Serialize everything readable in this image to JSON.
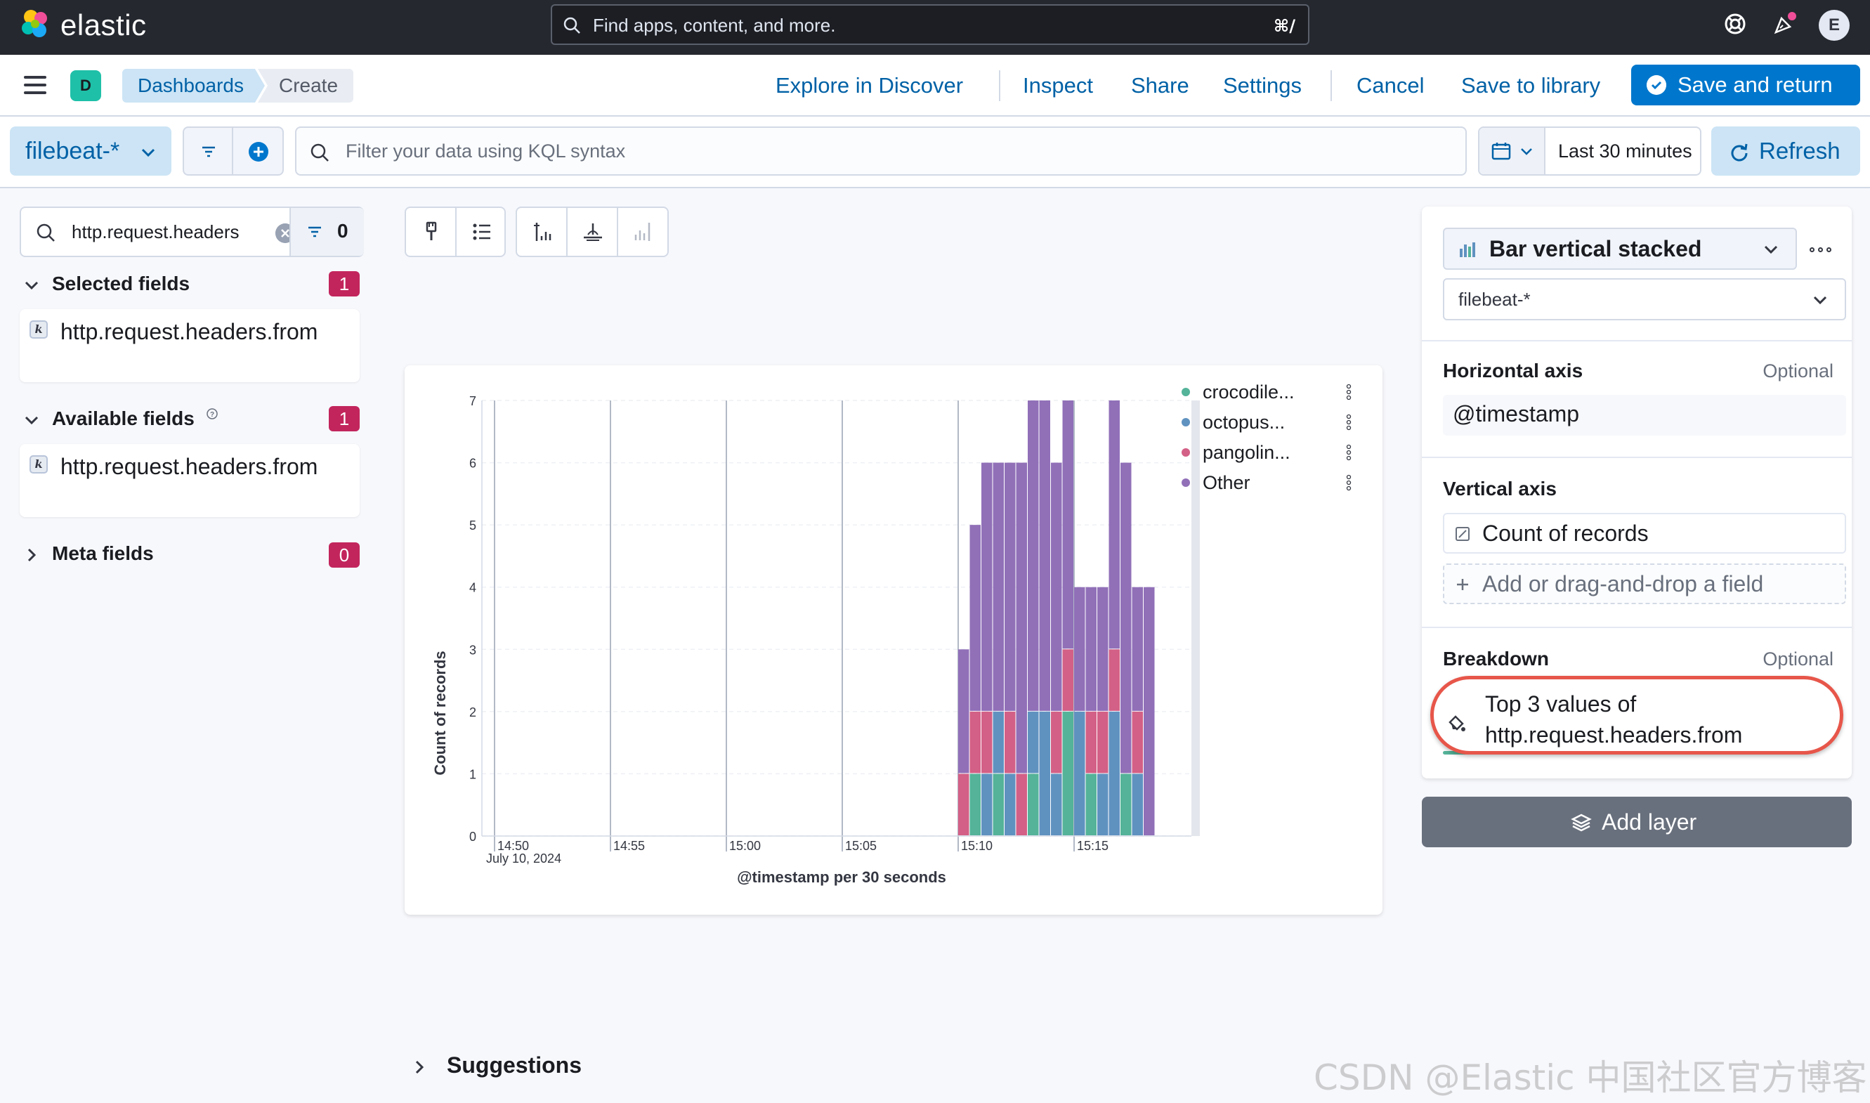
{
  "header": {
    "logo_text": "elastic",
    "search_placeholder": "Find apps, content, and more.",
    "search_shortcut": "⌘/",
    "avatar_initial": "E"
  },
  "appbar": {
    "space_initial": "D",
    "breadcrumbs": [
      "Dashboards",
      "Create"
    ],
    "links": [
      "Explore in Discover",
      "Inspect",
      "Share",
      "Settings",
      "Cancel",
      "Save to library"
    ],
    "save_return_label": "Save and return"
  },
  "querybar": {
    "data_view": "filebeat-*",
    "kql_placeholder": "Filter your data using KQL syntax",
    "time_range": "Last 30 minutes",
    "refresh_label": "Refresh"
  },
  "field_list": {
    "search_value": "http.request.headers",
    "filter_count": "0",
    "sections": [
      {
        "title": "Selected fields",
        "count": "1",
        "fields": [
          "http.request.headers.from"
        ]
      },
      {
        "title": "Available fields",
        "count": "1",
        "fields": [
          "http.request.headers.from"
        ]
      },
      {
        "title": "Meta fields",
        "count": "0",
        "fields": []
      }
    ]
  },
  "workspace": {
    "toolbar_icons": [
      "paintbrush-icon",
      "legend-icon",
      "left-axis-icon",
      "bottom-axis-icon",
      "right-axis-icon"
    ],
    "suggestions_label": "Suggestions"
  },
  "chart_data": {
    "type": "bar",
    "stacked": true,
    "title": "",
    "xlabel": "@timestamp per 30 seconds",
    "ylabel": "Count of records",
    "ylim": [
      0,
      7
    ],
    "y_ticks": [
      0,
      1,
      2,
      3,
      4,
      5,
      6,
      7
    ],
    "x_tick_labels": [
      "14:50",
      "14:55",
      "15:00",
      "15:05",
      "15:10",
      "15:15"
    ],
    "x_sub_label": "July 10, 2024",
    "x": [
      "15:10:30",
      "15:11:00",
      "15:11:30",
      "15:12:00",
      "15:12:30",
      "15:13:00",
      "15:13:30",
      "15:14:00",
      "15:14:30",
      "15:15:00",
      "15:15:30",
      "15:16:00",
      "15:16:30",
      "15:17:00",
      "15:17:30",
      "15:18:00",
      "15:18:30"
    ],
    "series": [
      {
        "name": "crocodile...",
        "color": "#54b399",
        "values": [
          0,
          1,
          0,
          1,
          0,
          0,
          1,
          0,
          0,
          2,
          0,
          1,
          0,
          0,
          1,
          0,
          0
        ]
      },
      {
        "name": "octopus...",
        "color": "#6092c0",
        "values": [
          0,
          0,
          1,
          1,
          1,
          0,
          1,
          2,
          1,
          0,
          2,
          0,
          1,
          2,
          0,
          1,
          0
        ]
      },
      {
        "name": "pangolin...",
        "color": "#d36086",
        "values": [
          1,
          1,
          1,
          0,
          1,
          1,
          0,
          0,
          1,
          1,
          0,
          1,
          1,
          1,
          0,
          1,
          0
        ]
      },
      {
        "name": "Other",
        "color": "#9170b8",
        "values": [
          2,
          3,
          4,
          4,
          4,
          5,
          5,
          5,
          4,
          4,
          2,
          2,
          2,
          4,
          5,
          2,
          4
        ]
      }
    ],
    "grid": true,
    "legend_position": "right"
  },
  "config": {
    "chart_type": "Bar vertical stacked",
    "data_view": "filebeat-*",
    "horizontal_axis_label": "Horizontal axis",
    "horizontal_axis_optional": "Optional",
    "horizontal_axis_value": "@timestamp",
    "vertical_axis_label": "Vertical axis",
    "vertical_axis_value": "Count of records",
    "add_field_label": "Add or drag-and-drop a field",
    "breakdown_label": "Breakdown",
    "breakdown_optional": "Optional",
    "breakdown_value": "Top 3 values of http.request.headers.from",
    "add_layer_label": "Add layer"
  },
  "watermark": "CSDN @Elastic 中国社区官方博客"
}
